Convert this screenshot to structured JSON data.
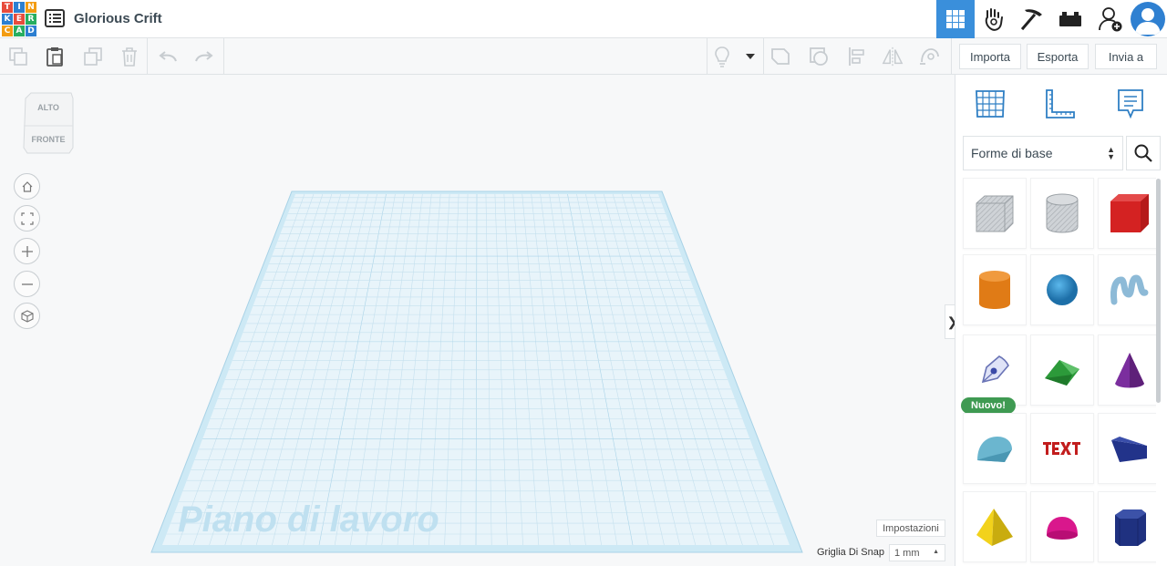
{
  "app": {
    "logo_letters": [
      "T",
      "I",
      "N",
      "K",
      "E",
      "R",
      "C",
      "A",
      "D"
    ],
    "logo_colors": [
      "#e74c3c",
      "#2c7fd1",
      "#f39c12",
      "#2c7fd1",
      "#e74c3c",
      "#27ae60",
      "#f39c12",
      "#27ae60",
      "#2c7fd1"
    ],
    "design_title": "Glorious Crift"
  },
  "header": {
    "buttons": [
      {
        "name": "3d-view",
        "icon": "grid-icon",
        "active": true
      },
      {
        "name": "codeblocks",
        "icon": "hand-icon",
        "active": false
      },
      {
        "name": "minecraft",
        "icon": "pickaxe-icon",
        "active": false
      },
      {
        "name": "bricks",
        "icon": "brick-icon",
        "active": false
      },
      {
        "name": "invite-user",
        "icon": "add-user-icon",
        "active": false
      }
    ],
    "accent": "#3a8fdb"
  },
  "toolbar": {
    "import_label": "Importa",
    "export_label": "Esporta",
    "send_label": "Invia a"
  },
  "panel": {
    "category": "Forme di base",
    "new_badge": "Nuovo!",
    "shapes": [
      {
        "name": "box-hole",
        "icon": "box-hole-icon"
      },
      {
        "name": "cylinder-hole",
        "icon": "cylinder-hole-icon"
      },
      {
        "name": "box",
        "icon": "red-box-icon"
      },
      {
        "name": "cylinder",
        "icon": "orange-cylinder-icon"
      },
      {
        "name": "sphere",
        "icon": "blue-sphere-icon"
      },
      {
        "name": "scribble",
        "icon": "scribble-icon"
      },
      {
        "name": "shape-generator",
        "icon": "pen-icon"
      },
      {
        "name": "roof",
        "icon": "green-roof-icon"
      },
      {
        "name": "cone",
        "icon": "purple-cone-icon"
      },
      {
        "name": "round-roof",
        "icon": "round-roof-icon"
      },
      {
        "name": "text",
        "icon": "red-text-icon"
      },
      {
        "name": "wedge",
        "icon": "navy-wedge-icon"
      },
      {
        "name": "pyramid",
        "icon": "yellow-pyramid-icon"
      },
      {
        "name": "half-sphere",
        "icon": "magenta-half-sphere-icon"
      },
      {
        "name": "polygon",
        "icon": "navy-polygon-icon"
      }
    ]
  },
  "viewport": {
    "viewcube_top": "ALTO",
    "viewcube_front": "FRONTE",
    "workplane_label": "Piano di lavoro",
    "settings_label": "Impostazioni",
    "snap_label": "Griglia Di Snap",
    "snap_value": "1 mm"
  }
}
